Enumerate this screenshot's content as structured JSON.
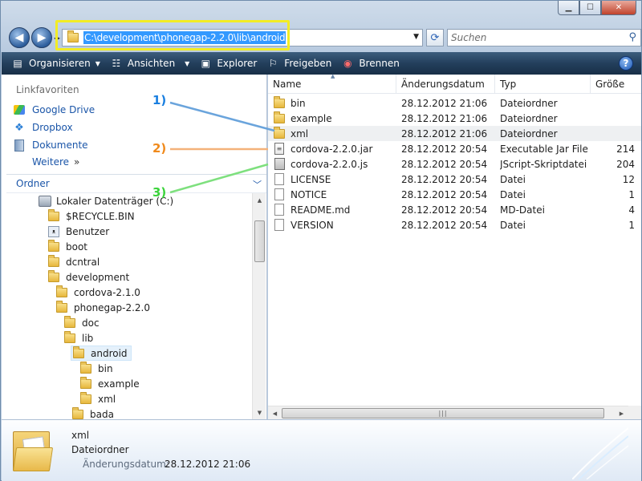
{
  "window": {
    "minimize_glyph": "▁",
    "maximize_glyph": "☐",
    "close_glyph": "✕"
  },
  "addressbar": {
    "path": "C:\\development\\phonegap-2.2.0\\lib\\android",
    "search_placeholder": "Suchen"
  },
  "toolbar": {
    "organize": "Organisieren",
    "views": "Ansichten",
    "explorer": "Explorer",
    "share": "Freigeben",
    "burn": "Brennen",
    "help": "?"
  },
  "nav": {
    "favorites_header": "Linkfavoriten",
    "favorites": [
      {
        "label": "Google Drive",
        "icon": "google-drive-icon"
      },
      {
        "label": "Dropbox",
        "icon": "dropbox-icon"
      },
      {
        "label": "Dokumente",
        "icon": "documents-icon"
      },
      {
        "label": "Weitere",
        "icon": "double-chevron-icon"
      }
    ],
    "folders_header": "Ordner",
    "tree": [
      {
        "label": "Lokaler Datenträger (C:)",
        "depth": 0,
        "icon": "drive-icon"
      },
      {
        "label": "$RECYCLE.BIN",
        "depth": 1,
        "icon": "folder-icon"
      },
      {
        "label": "Benutzer",
        "depth": 1,
        "icon": "users-folder-icon"
      },
      {
        "label": "boot",
        "depth": 1,
        "icon": "folder-icon"
      },
      {
        "label": "dcntral",
        "depth": 1,
        "icon": "folder-icon"
      },
      {
        "label": "development",
        "depth": 1,
        "icon": "folder-icon"
      },
      {
        "label": "cordova-2.1.0",
        "depth": 2,
        "icon": "folder-icon"
      },
      {
        "label": "phonegap-2.2.0",
        "depth": 2,
        "icon": "folder-icon"
      },
      {
        "label": "doc",
        "depth": 3,
        "icon": "folder-icon"
      },
      {
        "label": "lib",
        "depth": 3,
        "icon": "folder-icon"
      },
      {
        "label": "android",
        "depth": 4,
        "icon": "folder-icon",
        "selected": true
      },
      {
        "label": "bin",
        "depth": 5,
        "icon": "folder-icon"
      },
      {
        "label": "example",
        "depth": 5,
        "icon": "folder-icon"
      },
      {
        "label": "xml",
        "depth": 5,
        "icon": "folder-icon"
      },
      {
        "label": "bada",
        "depth": 4,
        "icon": "folder-icon"
      }
    ]
  },
  "list": {
    "columns": {
      "name": "Name",
      "date": "Änderungsdatum",
      "type": "Typ",
      "size": "Größe"
    },
    "rows": [
      {
        "name": "bin",
        "date": "28.12.2012 21:06",
        "type": "Dateiordner",
        "size": "",
        "icon": "folder-icon"
      },
      {
        "name": "example",
        "date": "28.12.2012 21:06",
        "type": "Dateiordner",
        "size": "",
        "icon": "folder-icon"
      },
      {
        "name": "xml",
        "date": "28.12.2012 21:06",
        "type": "Dateiordner",
        "size": "",
        "icon": "folder-icon",
        "highlight": true
      },
      {
        "name": "cordova-2.2.0.jar",
        "date": "28.12.2012 20:54",
        "type": "Executable Jar File",
        "size": "214",
        "icon": "jar-file-icon"
      },
      {
        "name": "cordova-2.2.0.js",
        "date": "28.12.2012 20:54",
        "type": "JScript-Skriptdatei",
        "size": "204",
        "icon": "script-file-icon"
      },
      {
        "name": "LICENSE",
        "date": "28.12.2012 20:54",
        "type": "Datei",
        "size": "12",
        "icon": "file-icon"
      },
      {
        "name": "NOTICE",
        "date": "28.12.2012 20:54",
        "type": "Datei",
        "size": "1",
        "icon": "file-icon"
      },
      {
        "name": "README.md",
        "date": "28.12.2012 20:54",
        "type": "MD-Datei",
        "size": "4",
        "icon": "file-icon"
      },
      {
        "name": "VERSION",
        "date": "28.12.2012 20:54",
        "type": "Datei",
        "size": "1",
        "icon": "file-icon"
      }
    ]
  },
  "details": {
    "name": "xml",
    "type": "Dateiordner",
    "date_label": "Änderungsdatum:",
    "date": "28.12.2012 21:06"
  },
  "annotations": [
    {
      "label": "1)",
      "color": "#1a7fe0",
      "line_color": "#6aa4dc"
    },
    {
      "label": "2)",
      "color": "#f08a1c",
      "line_color": "#f4b27a"
    },
    {
      "label": "3)",
      "color": "#3bd33b",
      "line_color": "#7ee07e"
    }
  ],
  "colors": {
    "selection": "#3399ff",
    "highlight_box": "#f2ec24",
    "toolbar": "#233f5c",
    "link": "#1a55a8"
  }
}
